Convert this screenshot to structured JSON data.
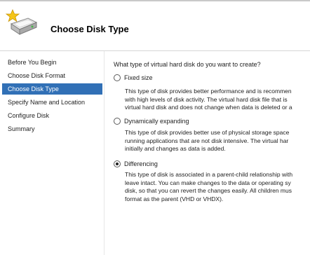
{
  "header": {
    "title": "Choose Disk Type",
    "icon": "disk-star-icon"
  },
  "sidebar": {
    "items": [
      {
        "label": "Before You Begin",
        "selected": false
      },
      {
        "label": "Choose Disk Format",
        "selected": false
      },
      {
        "label": "Choose Disk Type",
        "selected": true
      },
      {
        "label": "Specify Name and Location",
        "selected": false
      },
      {
        "label": "Configure Disk",
        "selected": false
      },
      {
        "label": "Summary",
        "selected": false
      }
    ],
    "selected_color": "#3170b6"
  },
  "main": {
    "question": "What type of virtual hard disk do you want to create?",
    "options": [
      {
        "label": "Fixed size",
        "checked": false,
        "description": [
          "This type of disk provides better performance and is recommen",
          "with high levels of disk activity. The virtual hard disk file that is",
          "virtual hard disk and does not change when data is deleted or a"
        ]
      },
      {
        "label": "Dynamically expanding",
        "checked": false,
        "description": [
          "This type of disk provides better use of physical storage space",
          "running applications that are not disk intensive. The virtual har",
          "initially and changes as data is added."
        ]
      },
      {
        "label": "Differencing",
        "checked": true,
        "description": [
          "This type of disk is associated in a parent-child relationship with",
          "leave intact. You can make changes to the data or operating sy",
          "disk, so that you can revert the changes easily. All children mus",
          "format as the parent (VHD or VHDX)."
        ]
      }
    ]
  }
}
